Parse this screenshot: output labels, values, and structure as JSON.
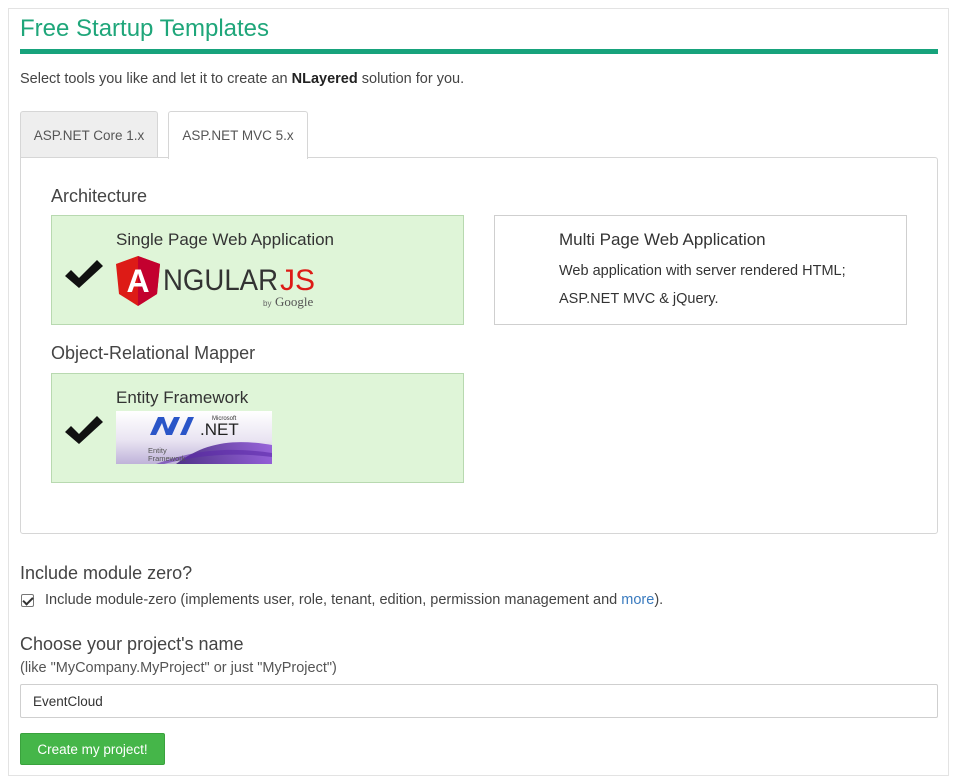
{
  "header": {
    "title": "Free Startup Templates",
    "intro_prefix": "Select tools you like and let it to create an ",
    "intro_bold": "NLayered",
    "intro_suffix": " solution for you."
  },
  "tabs": [
    {
      "label": "ASP.NET Core 1.x",
      "active": false
    },
    {
      "label": "ASP.NET MVC 5.x",
      "active": true
    }
  ],
  "architecture": {
    "heading": "Architecture",
    "options": [
      {
        "title": "Single Page Web Application",
        "selected": true,
        "logo": "angularjs-logo"
      },
      {
        "title": "Multi Page Web Application",
        "selected": false,
        "description": "Web application with server rendered HTML; ASP.NET MVC & jQuery."
      }
    ]
  },
  "orm": {
    "heading": "Object-Relational Mapper",
    "options": [
      {
        "title": "Entity Framework",
        "selected": true,
        "logo": "entity-framework-logo"
      }
    ]
  },
  "logos": {
    "angular": {
      "letter": "A",
      "text": "NGULAR",
      "suffix": "JS",
      "by": "by",
      "google": "Google"
    },
    "ef": {
      "microsoft": "Microsoft",
      "net": ".NET",
      "line1": "Entity",
      "line2": "Framework"
    }
  },
  "module_zero": {
    "heading": "Include module zero?",
    "checked": true,
    "label": "Include module-zero (implements user, role, tenant, edition, permission management and ",
    "link": "more",
    "label_end": ")."
  },
  "project_name": {
    "heading": "Choose your project's name",
    "hint": "(like \"MyCompany.MyProject\" or just \"MyProject\")",
    "value": "EventCloud"
  },
  "actions": {
    "create_label": "Create my project!"
  },
  "colors": {
    "accent": "#1fa67a",
    "selected_bg": "#dff5d8",
    "button": "#45b649",
    "angular_red": "#dd1b16",
    "link": "#3a7bbf"
  }
}
